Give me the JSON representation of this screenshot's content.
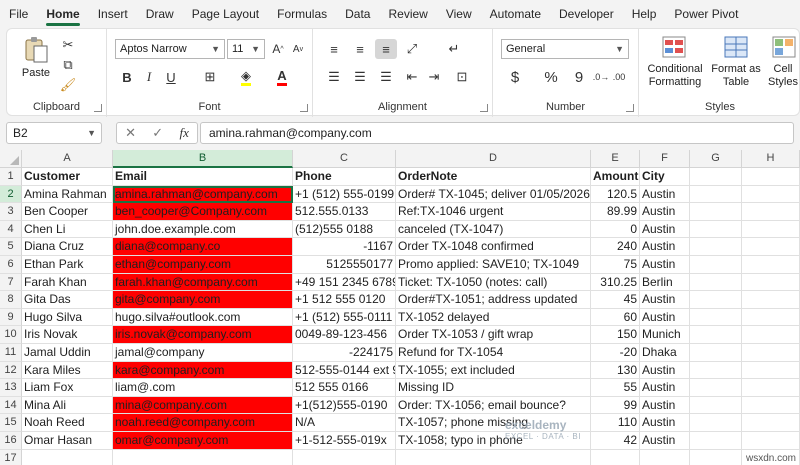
{
  "menu": [
    "File",
    "Home",
    "Insert",
    "Draw",
    "Page Layout",
    "Formulas",
    "Data",
    "Review",
    "View",
    "Automate",
    "Developer",
    "Help",
    "Power Pivot"
  ],
  "ribbon": {
    "clipboard": {
      "label": "Clipboard",
      "paste": "Paste"
    },
    "font": {
      "label": "Font",
      "family": "Aptos Narrow",
      "size": "11",
      "bold": "B",
      "italic": "I",
      "underline": "U"
    },
    "alignment": {
      "label": "Alignment"
    },
    "number": {
      "label": "Number",
      "format": "General",
      "currency": "$",
      "percent": "%",
      "comma": "9"
    },
    "styles": {
      "label": "Styles",
      "conditional": "Conditional Formatting",
      "format_table": "Format as Table",
      "cell_styles": "Cell Styles"
    }
  },
  "formula_bar": {
    "name_box": "B2",
    "fx": "fx",
    "value": "amina.rahman@company.com"
  },
  "columns": [
    "A",
    "B",
    "C",
    "D",
    "E",
    "F",
    "G",
    "H"
  ],
  "rows": [
    "1",
    "2",
    "3",
    "4",
    "5",
    "6",
    "7",
    "8",
    "9",
    "10",
    "11",
    "12",
    "13",
    "14",
    "15",
    "16",
    "17"
  ],
  "headers": [
    "Customer",
    "Email",
    "Phone",
    "OrderNote",
    "Amount",
    "City"
  ],
  "data": [
    {
      "customer": "Amina Rahman",
      "email": "amina.rahman@company.com",
      "phone": "+1 (512) 555-0199",
      "note": "Order# TX-1045; deliver 01/05/2026",
      "amount": "120.5",
      "city": "Austin",
      "red": true,
      "phone_num": false
    },
    {
      "customer": "Ben Cooper",
      "email": "ben_cooper@Company.com",
      "phone": "512.555.0133",
      "note": "Ref:TX-1046 urgent",
      "amount": "89.99",
      "city": "Austin",
      "red": true,
      "phone_num": false
    },
    {
      "customer": "Chen Li",
      "email": "john.doe.example.com",
      "phone": "(512)555 0188",
      "note": "canceled (TX-1047)",
      "amount": "0",
      "city": "Austin",
      "red": false,
      "phone_num": false
    },
    {
      "customer": "Diana Cruz",
      "email": "diana@company.co",
      "phone": "-1167",
      "note": "Order TX-1048 confirmed",
      "amount": "240",
      "city": "Austin",
      "red": true,
      "phone_num": true
    },
    {
      "customer": "Ethan Park",
      "email": "ethan@company.com",
      "phone": "5125550177",
      "note": "Promo applied: SAVE10; TX-1049",
      "amount": "75",
      "city": "Austin",
      "red": true,
      "phone_num": true
    },
    {
      "customer": "Farah Khan",
      "email": "farah.khan@company.com",
      "phone": "+49 151 2345 6789",
      "note": "Ticket: TX-1050 (notes: call)",
      "amount": "310.25",
      "city": "Berlin",
      "red": true,
      "phone_num": false
    },
    {
      "customer": "Gita Das",
      "email": "gita@company.com",
      "phone": "+1 512 555 0120",
      "note": "Order#TX-1051; address updated",
      "amount": "45",
      "city": "Austin",
      "red": true,
      "phone_num": false
    },
    {
      "customer": "Hugo Silva",
      "email": "hugo.silva#outlook.com",
      "phone": "+1 (512) 555-0111",
      "note": "TX-1052 delayed",
      "amount": "60",
      "city": "Austin",
      "red": false,
      "phone_num": false
    },
    {
      "customer": "Iris Novak",
      "email": "iris.novak@company.com",
      "phone": "0049-89-123-456",
      "note": "Order TX-1053 / gift wrap",
      "amount": "150",
      "city": "Munich",
      "red": true,
      "phone_num": false
    },
    {
      "customer": "Jamal Uddin",
      "email": "jamal@company",
      "phone": "-224175",
      "note": "Refund for TX-1054",
      "amount": "-20",
      "city": "Dhaka",
      "red": false,
      "phone_num": true
    },
    {
      "customer": "Kara Miles",
      "email": "kara@company.com",
      "phone": "512-555-0144 ext 9",
      "note": "TX-1055; ext included",
      "amount": "130",
      "city": "Austin",
      "red": true,
      "phone_num": false
    },
    {
      "customer": "Liam Fox",
      "email": "liam@.com",
      "phone": "512 555 0166",
      "note": "Missing ID",
      "amount": "55",
      "city": "Austin",
      "red": false,
      "phone_num": false
    },
    {
      "customer": "Mina Ali",
      "email": "mina@company.com",
      "phone": "+1(512)555-0190",
      "note": "Order: TX-1056; email bounce?",
      "amount": "99",
      "city": "Austin",
      "red": true,
      "phone_num": false
    },
    {
      "customer": "Noah Reed",
      "email": "noah.reed@company.com",
      "phone": "N/A",
      "note": "TX-1057; phone missing",
      "amount": "110",
      "city": "Austin",
      "red": true,
      "phone_num": false
    },
    {
      "customer": "Omar Hasan",
      "email": "omar@company.com",
      "phone": "+1-512-555-019x",
      "note": "TX-1058; typo in phone",
      "amount": "42",
      "city": "Austin",
      "red": true,
      "phone_num": false
    }
  ],
  "watermark": {
    "name": "exceldemy",
    "tagline": "EXCEL · DATA · BI"
  },
  "site_tag": "wsxdn.com",
  "colors": {
    "accent": "#1a7343",
    "highlight_red": "#ff0000",
    "selected_header": "#d3ecd9"
  }
}
